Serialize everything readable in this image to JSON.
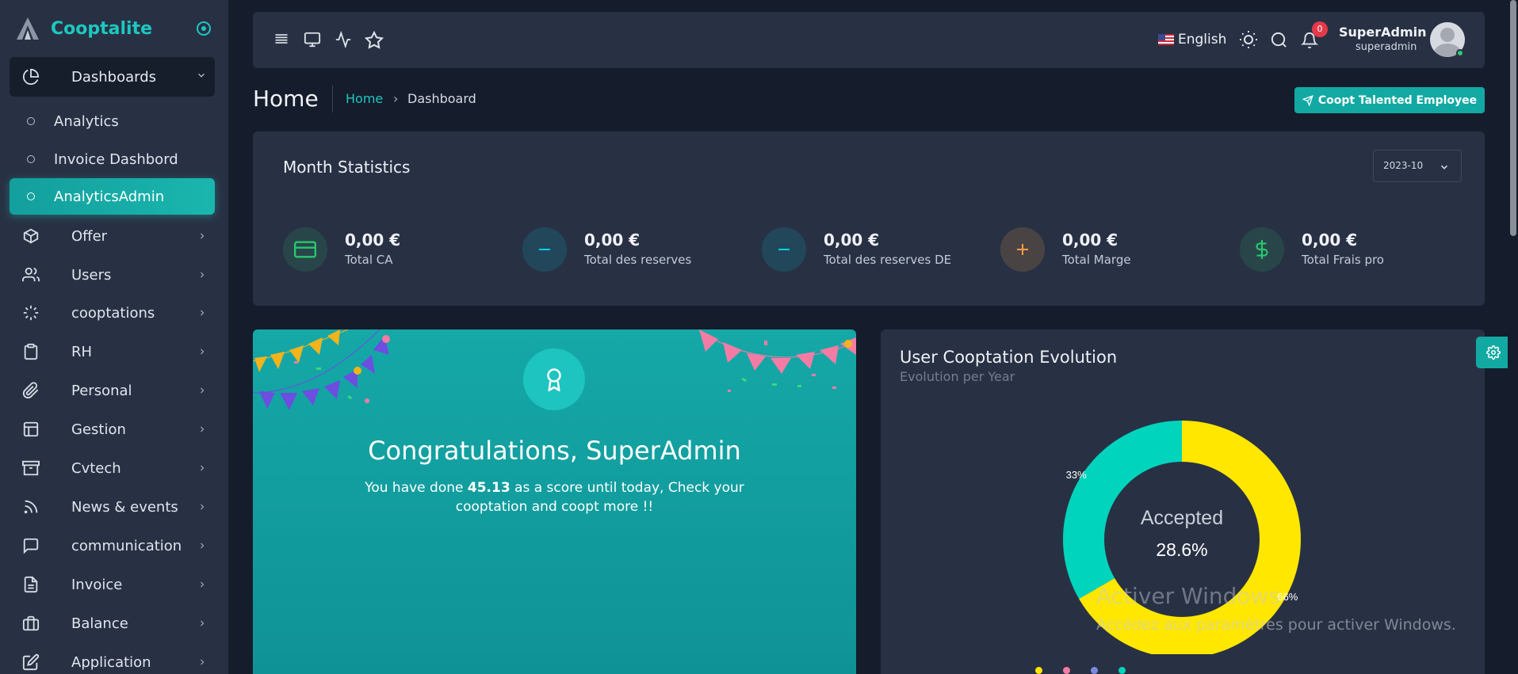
{
  "app": {
    "name": "Cooptalite"
  },
  "sidebar": {
    "dashboards": {
      "label": "Dashboards"
    },
    "sub_items": [
      {
        "label": "Analytics",
        "active": false
      },
      {
        "label": "Invoice Dashbord",
        "active": false
      },
      {
        "label": "AnalyticsAdmin",
        "active": true
      }
    ],
    "items": [
      {
        "label": "Offer",
        "icon": "box-icon"
      },
      {
        "label": "Users",
        "icon": "users-icon"
      },
      {
        "label": "cooptations",
        "icon": "loader-icon"
      },
      {
        "label": "RH",
        "icon": "clipboard-icon"
      },
      {
        "label": "Personal",
        "icon": "paperclip-icon"
      },
      {
        "label": "Gestion",
        "icon": "layout-icon"
      },
      {
        "label": "Cvtech",
        "icon": "archive-icon"
      },
      {
        "label": "News & events",
        "icon": "rss-icon"
      },
      {
        "label": "communication",
        "icon": "message-icon"
      },
      {
        "label": "Invoice",
        "icon": "file-text-icon"
      },
      {
        "label": "Balance",
        "icon": "briefcase-icon"
      },
      {
        "label": "Application",
        "icon": "edit-icon"
      }
    ]
  },
  "topbar": {
    "language": "English",
    "notifications_count": "0",
    "user_name": "SuperAdmin",
    "user_login": "superadmin"
  },
  "page": {
    "title": "Home",
    "breadcrumb_home": "Home",
    "breadcrumb_separator": "›",
    "breadcrumb_current": "Dashboard",
    "action_button": "Coopt Talented Employee"
  },
  "stats": {
    "title": "Month Statistics",
    "month": "2023-10",
    "items": [
      {
        "value": "0,00 €",
        "label": "Total CA",
        "icon": "credit-card-icon",
        "color": "#28c76f"
      },
      {
        "value": "0,00 €",
        "label": "Total des reserves",
        "icon": "minus-icon",
        "color": "#00cfe8"
      },
      {
        "value": "0,00 €",
        "label": "Total des reserves DE",
        "icon": "minus-icon",
        "color": "#00cfe8"
      },
      {
        "value": "0,00 €",
        "label": "Total Marge",
        "icon": "plus-icon",
        "color": "#ff9f43"
      },
      {
        "value": "0,00 €",
        "label": "Total Frais pro",
        "icon": "dollar-icon",
        "color": "#28c76f"
      }
    ]
  },
  "congrats": {
    "title": "Congratulations, SuperAdmin",
    "text_before": "You have done ",
    "score": "45.13",
    "text_after": " as a score until today, Check your cooptation and coopt more !!"
  },
  "evolution": {
    "title": "User Cooptation Evolution",
    "subtitle": "Evolution per Year",
    "center_label": "Accepted",
    "center_value": "28.6%",
    "colors": {
      "yellow": "#ffe700",
      "teal": "#00d4bd"
    }
  },
  "chart_data": {
    "type": "pie",
    "slice_labels": [
      "66%",
      "33%"
    ],
    "values": [
      66,
      33
    ],
    "colors": [
      "#ffe700",
      "#00d4bd"
    ],
    "center_label": "Accepted",
    "center_value": "28.6%"
  },
  "watermark": {
    "line1": "Activer Windows",
    "line2": "Accédez aux paramètres pour activer Windows."
  }
}
